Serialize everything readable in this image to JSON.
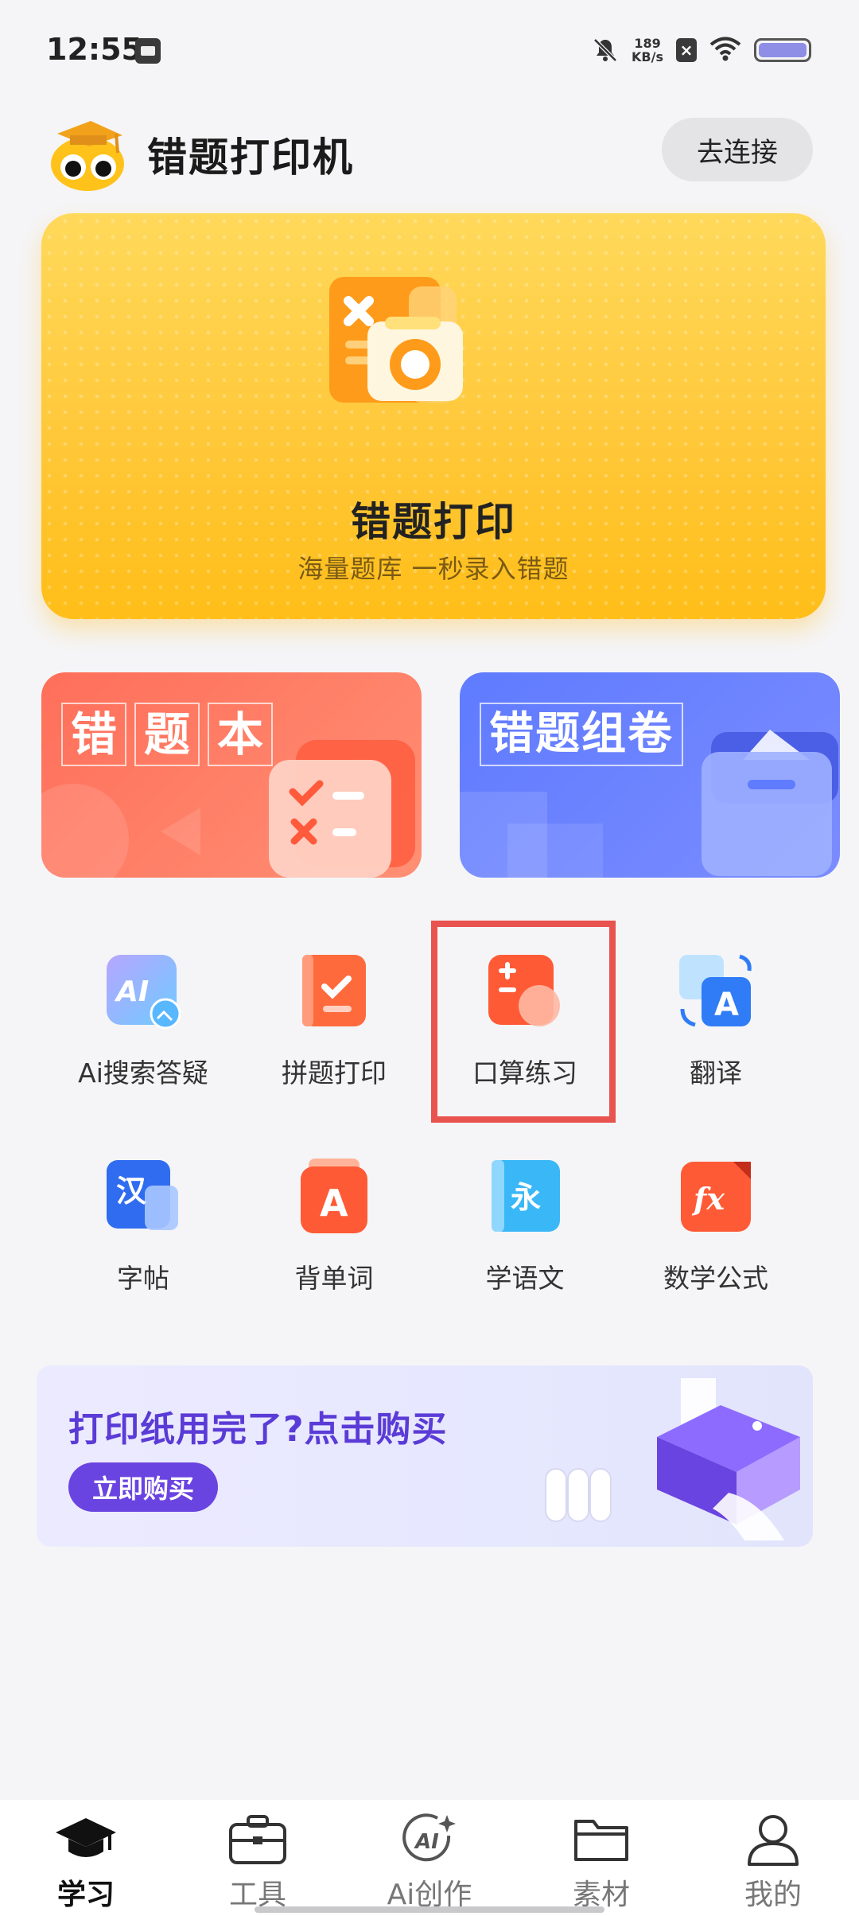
{
  "status_bar": {
    "time": "12:55",
    "speed_value": "189",
    "speed_unit": "KB/s"
  },
  "header": {
    "title": "错题打印机",
    "connect_label": "去连接"
  },
  "hero": {
    "title": "错题打印",
    "subtitle": "海量题库   一秒录入错题",
    "colors": {
      "top": "#ffd95b",
      "bottom": "#ffbe18"
    }
  },
  "cards": {
    "mistake_book": {
      "title_chars": [
        "错",
        "题",
        "本"
      ],
      "color": "#ff7a63"
    },
    "mistake_compose": {
      "title": "错题组卷",
      "color": "#6a82ff"
    }
  },
  "tools": [
    {
      "label": "Ai搜索答疑",
      "icon": "ai-search-icon"
    },
    {
      "label": "拼题打印",
      "icon": "puzzle-print-icon"
    },
    {
      "label": "口算练习",
      "icon": "mental-math-icon"
    },
    {
      "label": "翻译",
      "icon": "translate-icon"
    },
    {
      "label": "字帖",
      "icon": "copybook-icon",
      "glyph": "汉"
    },
    {
      "label": "背单词",
      "icon": "vocabulary-icon",
      "glyph": "A"
    },
    {
      "label": "学语文",
      "icon": "chinese-icon",
      "glyph": "永"
    },
    {
      "label": "数学公式",
      "icon": "math-formula-icon",
      "glyph": "fx"
    }
  ],
  "banner": {
    "title": "打印纸用完了?点击购买",
    "button_label": "立即购买"
  },
  "bottom_nav": [
    {
      "label": "学习",
      "icon": "graduation-cap-icon",
      "active": true
    },
    {
      "label": "工具",
      "icon": "briefcase-icon",
      "active": false
    },
    {
      "label": "Ai创作",
      "icon": "ai-create-icon",
      "active": false
    },
    {
      "label": "素材",
      "icon": "folder-icon",
      "active": false
    },
    {
      "label": "我的",
      "icon": "person-icon",
      "active": false
    }
  ],
  "accent_colors": {
    "highlight_box": "#e8524f",
    "banner_purple": "#6a44e0"
  }
}
